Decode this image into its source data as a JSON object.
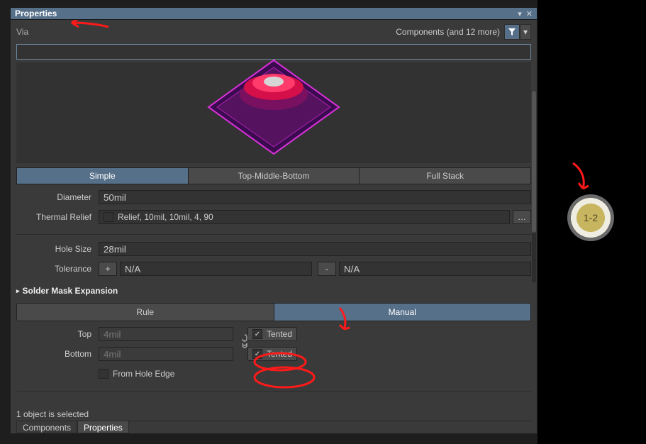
{
  "panel": {
    "title": "Properties",
    "obj": "Via",
    "filter_label": "Components (and 12 more)"
  },
  "tabs_mode": {
    "simple": "Simple",
    "tmb": "Top-Middle-Bottom",
    "full": "Full Stack"
  },
  "fields": {
    "diameter_label": "Diameter",
    "diameter_val": "50mil",
    "thermal_label": "Thermal Relief",
    "thermal_val": "Relief, 10mil, 10mil, 4, 90",
    "hole_label": "Hole Size",
    "hole_val": "28mil",
    "tol_label": "Tolerance",
    "tol_plus": "+",
    "tol_minus": "-",
    "tol_na": "N/A"
  },
  "smask": {
    "section": "Solder Mask Expansion",
    "rule": "Rule",
    "manual": "Manual",
    "top_label": "Top",
    "top_val": "4mil",
    "bottom_label": "Bottom",
    "bottom_val": "4mil",
    "tented": "Tented",
    "from_hole": "From Hole Edge"
  },
  "status": "1 object is selected",
  "bottom_tabs": {
    "components": "Components",
    "properties": "Properties"
  },
  "via_pad": "1-2"
}
